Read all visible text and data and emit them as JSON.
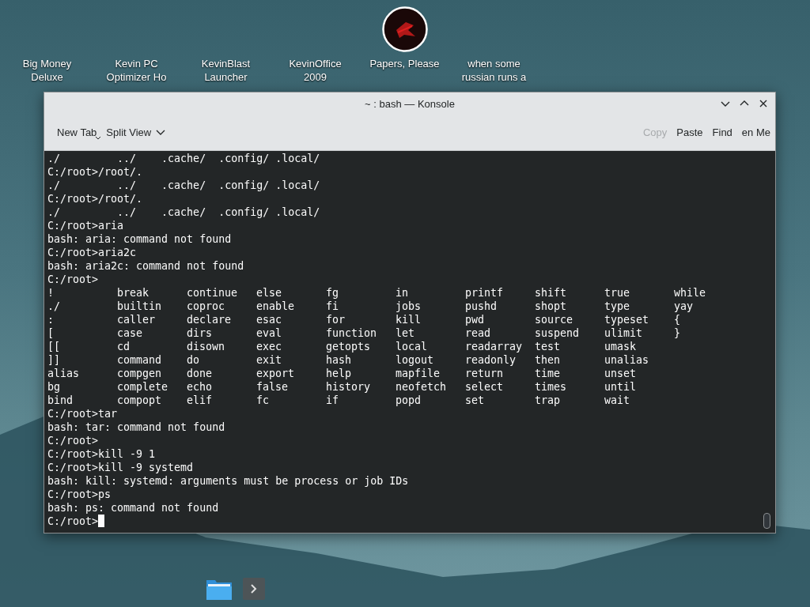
{
  "desktop_icons": [
    {
      "label": "Big Money Deluxe",
      "has_icon": false
    },
    {
      "label": "Kevin PC Optimizer Ho",
      "has_icon": false
    },
    {
      "label": "KevinBlast Launcher",
      "has_icon": false
    },
    {
      "label": "KevinOffice 2009",
      "has_icon": false
    },
    {
      "label": "Papers, Please",
      "has_icon": true
    },
    {
      "label": "when some russian runs a",
      "has_icon": false
    }
  ],
  "window": {
    "title": "~ : bash — Konsole",
    "toolbar": [
      {
        "label": "New Tab",
        "kind": "menu",
        "disabled": false
      },
      {
        "label": "Split View",
        "kind": "dropdown",
        "disabled": false
      },
      {
        "label": "Copy",
        "kind": "spacer-button",
        "disabled": true
      },
      {
        "label": "Paste",
        "kind": "button",
        "disabled": false
      },
      {
        "label": "Find",
        "kind": "button",
        "disabled": false
      },
      {
        "label": "en Me",
        "kind": "button",
        "disabled": false
      }
    ]
  },
  "terminal": {
    "lines_before": [
      "./         ../    .cache/  .config/ .local/",
      "C:/root>/root/.",
      "./         ../    .cache/  .config/ .local/",
      "C:/root>/root/.",
      "./         ../    .cache/  .config/ .local/",
      "C:/root>aria",
      "bash: aria: command not found",
      "C:/root>aria2c",
      "bash: aria2c: command not found",
      "C:/root>"
    ],
    "completion_rows": [
      [
        "!",
        "break",
        "continue",
        "else",
        "fg",
        "in",
        "printf",
        "shift",
        "true",
        "while"
      ],
      [
        "./",
        "builtin",
        "coproc",
        "enable",
        "fi",
        "jobs",
        "pushd",
        "shopt",
        "type",
        "yay"
      ],
      [
        ":",
        "caller",
        "declare",
        "esac",
        "for",
        "kill",
        "pwd",
        "source",
        "typeset",
        "{"
      ],
      [
        "[",
        "case",
        "dirs",
        "eval",
        "function",
        "let",
        "read",
        "suspend",
        "ulimit",
        "}"
      ],
      [
        "[[",
        "cd",
        "disown",
        "exec",
        "getopts",
        "local",
        "readarray",
        "test",
        "umask"
      ],
      [
        "]]",
        "command",
        "do",
        "exit",
        "hash",
        "logout",
        "readonly",
        "then",
        "unalias"
      ],
      [
        "alias",
        "compgen",
        "done",
        "export",
        "help",
        "mapfile",
        "return",
        "time",
        "unset"
      ],
      [
        "bg",
        "complete",
        "echo",
        "false",
        "history",
        "neofetch",
        "select",
        "times",
        "until"
      ],
      [
        "bind",
        "compopt",
        "elif",
        "fc",
        "if",
        "popd",
        "set",
        "trap",
        "wait"
      ]
    ],
    "lines_after": [
      "C:/root>tar",
      "bash: tar: command not found",
      "C:/root>",
      "C:/root>kill -9 1",
      "C:/root>kill -9 systemd",
      "bash: kill: systemd: arguments must be process or job IDs",
      "C:/root>ps",
      "bash: ps: command not found"
    ],
    "prompt": "C:/root>"
  }
}
